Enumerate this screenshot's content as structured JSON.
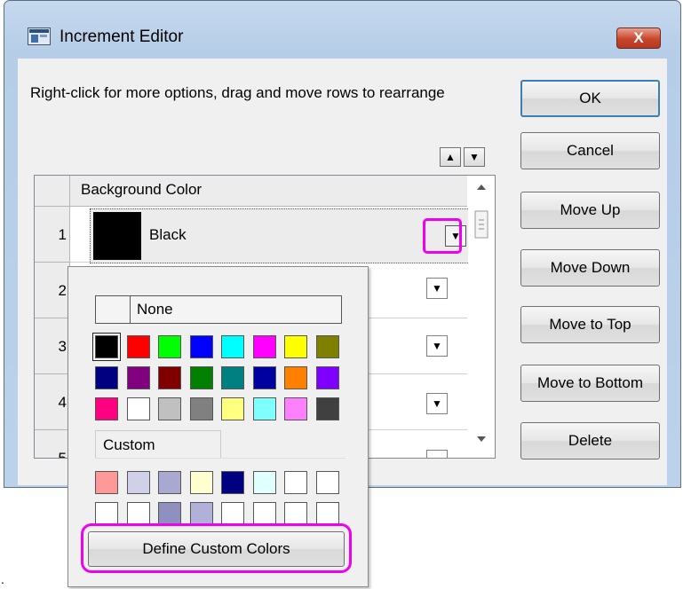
{
  "window": {
    "title": "Increment Editor",
    "close_label": "X"
  },
  "instructions": "Right-click for more options, drag and move rows to  rearrange",
  "buttons": {
    "ok": "OK",
    "cancel": "Cancel",
    "move_up": "Move Up",
    "move_down": "Move Down",
    "move_top": "Move to Top",
    "move_bottom": "Move to Bottom",
    "delete": "Delete"
  },
  "grid": {
    "column_header": "Background Color",
    "rows": [
      {
        "num": "1",
        "value": "Black"
      },
      {
        "num": "2",
        "value": ""
      },
      {
        "num": "3",
        "value": ""
      },
      {
        "num": "4",
        "value": ""
      },
      {
        "num": "5",
        "value": ""
      }
    ]
  },
  "popup": {
    "none_label": "None",
    "custom_label": "Custom",
    "define_button": "Define Custom Colors",
    "standard_colors": [
      [
        "#000000",
        "#ff0000",
        "#00ff00",
        "#0000ff",
        "#00ffff",
        "#ff00ff",
        "#ffff00",
        "#808000"
      ],
      [
        "#000080",
        "#800080",
        "#800000",
        "#008000",
        "#008080",
        "#0000a0",
        "#ff8000",
        "#8000ff"
      ],
      [
        "#ff0080",
        "#ffffff",
        "#c0c0c0",
        "#808080",
        "#ffff80",
        "#80ffff",
        "#ff80ff",
        "#404040"
      ]
    ],
    "custom_colors": [
      [
        "#ff9999",
        "#d0d0e8",
        "#a8a8d0",
        "#ffffd0",
        "#000080",
        "#e0ffff",
        "#ffffff",
        "#ffffff"
      ],
      [
        "#ffffff",
        "#ffffff",
        "#9090c0",
        "#b0b0d8",
        "#ffffff",
        "#ffffff",
        "#ffffff",
        "#ffffff"
      ]
    ]
  },
  "footer_mark": ".",
  "colors": {
    "highlight": "#f000f0"
  }
}
